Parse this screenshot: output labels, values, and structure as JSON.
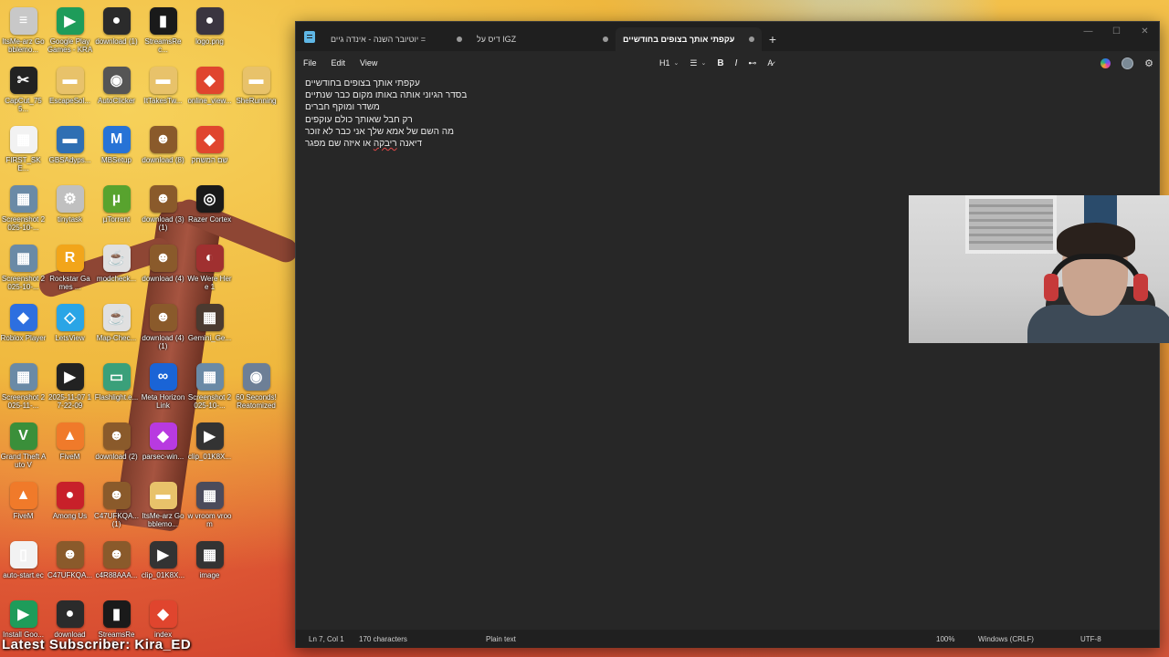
{
  "desktop": {
    "icons": [
      {
        "label": "ItsMe-arz Gobblemo...",
        "glyph": "≡",
        "color": "#c8c8c8"
      },
      {
        "label": "Google Play Games - KRA",
        "glyph": "▶",
        "color": "#1e9c5a"
      },
      {
        "label": "download (1)",
        "glyph": "●",
        "color": "#2b2b2b"
      },
      {
        "label": "StreamsRec...",
        "glyph": "▮",
        "color": "#1a1a1a"
      },
      {
        "label": "logo.png",
        "glyph": "●",
        "color": "#3a3540"
      },
      {
        "label": "",
        "glyph": "",
        "color": "transparent"
      },
      {
        "label": "CapCut_755...",
        "glyph": "✂",
        "color": "#222"
      },
      {
        "label": "EscapeSol...",
        "glyph": "▬",
        "color": "#e8c26a"
      },
      {
        "label": "AutoClicker",
        "glyph": "◉",
        "color": "#555"
      },
      {
        "label": "ItTakesTw...",
        "glyph": "▬",
        "color": "#e8c26a"
      },
      {
        "label": "online_view...",
        "glyph": "◆",
        "color": "#e0452e"
      },
      {
        "label": "SheRunning",
        "glyph": "▬",
        "color": "#e8c26a"
      },
      {
        "label": "FIRST_SKE...",
        "glyph": "▦",
        "color": "#f2f2f2"
      },
      {
        "label": "GBSAdyps...",
        "glyph": "▬",
        "color": "#2f6fb3"
      },
      {
        "label": "MBSetup",
        "glyph": "M",
        "color": "#2773d6"
      },
      {
        "label": "download (8)",
        "glyph": "☻",
        "color": "#8a5a2b"
      },
      {
        "label": "שם המשחק",
        "glyph": "◆",
        "color": "#e0452e"
      },
      {
        "label": "",
        "glyph": "",
        "color": "transparent"
      },
      {
        "label": "Screenshot 2025-10-...",
        "glyph": "▦",
        "color": "#6a8aa6"
      },
      {
        "label": "tinytask",
        "glyph": "⚙",
        "color": "#c0c0c0"
      },
      {
        "label": "µTorrent",
        "glyph": "µ",
        "color": "#58a32e"
      },
      {
        "label": "download (3) (1)",
        "glyph": "☻",
        "color": "#8a5a2b"
      },
      {
        "label": "Razer Cortex",
        "glyph": "◎",
        "color": "#1a1a1a"
      },
      {
        "label": "",
        "glyph": "",
        "color": "transparent"
      },
      {
        "label": "Screenshot 2025-10-...",
        "glyph": "▦",
        "color": "#6a8aa6"
      },
      {
        "label": "Rockstar Games ...",
        "glyph": "R",
        "color": "#f2a51a"
      },
      {
        "label": "modcheck...",
        "glyph": "☕",
        "color": "#e0e0e0"
      },
      {
        "label": "download (4)",
        "glyph": "☻",
        "color": "#8a5a2b"
      },
      {
        "label": "We Were Here 1",
        "glyph": "◐",
        "color": "#a03030"
      },
      {
        "label": "",
        "glyph": "",
        "color": "transparent"
      },
      {
        "label": "Roblox Player",
        "glyph": "◆",
        "color": "#2d6fe0"
      },
      {
        "label": "LetsView",
        "glyph": "◇",
        "color": "#2aa5e6"
      },
      {
        "label": "Map-Chec...",
        "glyph": "☕",
        "color": "#e0e0e0"
      },
      {
        "label": "download (4) (1)",
        "glyph": "☻",
        "color": "#8a5a2b"
      },
      {
        "label": "Gemini_Ge...",
        "glyph": "▦",
        "color": "#4a3a30"
      },
      {
        "label": "",
        "glyph": "",
        "color": "transparent"
      },
      {
        "label": "Screenshot 2025-11-...",
        "glyph": "▦",
        "color": "#6a8aa6"
      },
      {
        "label": "2025-11-07 17-22-09",
        "glyph": "▶",
        "color": "#222"
      },
      {
        "label": "Flashlight.e...",
        "glyph": "▭",
        "color": "#3aa07a"
      },
      {
        "label": "Meta Horizon Link",
        "glyph": "∞",
        "color": "#1a64d6"
      },
      {
        "label": "Screenshot 2025-10-...",
        "glyph": "▦",
        "color": "#6a8aa6"
      },
      {
        "label": "60 Seconds! Reatomized",
        "glyph": "◉",
        "color": "#6d7f96"
      },
      {
        "label": "Grand Theft Auto V",
        "glyph": "V",
        "color": "#3a8f3a"
      },
      {
        "label": "FiveM",
        "glyph": "▲",
        "color": "#f07a2a"
      },
      {
        "label": "download (2)",
        "glyph": "☻",
        "color": "#8a5a2b"
      },
      {
        "label": "parsec-win...",
        "glyph": "◆",
        "color": "#b83ae0"
      },
      {
        "label": "clip_01K8X...",
        "glyph": "▶",
        "color": "#333"
      },
      {
        "label": "",
        "glyph": "",
        "color": "transparent"
      },
      {
        "label": "FiveM",
        "glyph": "▲",
        "color": "#f07a2a"
      },
      {
        "label": "Among Us",
        "glyph": "●",
        "color": "#c8202a"
      },
      {
        "label": "C47UFKQA... (1)",
        "glyph": "☻",
        "color": "#8a5a2b"
      },
      {
        "label": "ItsMe-arz Gobblemo...",
        "glyph": "▬",
        "color": "#e8c26a"
      },
      {
        "label": "w vroom vroom",
        "glyph": "▦",
        "color": "#4b4b5b"
      },
      {
        "label": "",
        "glyph": "",
        "color": "transparent"
      },
      {
        "label": "auto-start.ec",
        "glyph": "▯",
        "color": "#f2f2f2"
      },
      {
        "label": "C47UFKQA...",
        "glyph": "☻",
        "color": "#8a5a2b"
      },
      {
        "label": "c4R88AAA...",
        "glyph": "☻",
        "color": "#8a5a2b"
      },
      {
        "label": "clip_01K8X...",
        "glyph": "▶",
        "color": "#333"
      },
      {
        "label": "image",
        "glyph": "▦",
        "color": "#333"
      },
      {
        "label": "",
        "glyph": "",
        "color": "transparent"
      },
      {
        "label": "Install Goo...",
        "glyph": "▶",
        "color": "#1e9c5a"
      },
      {
        "label": "download",
        "glyph": "●",
        "color": "#2b2b2b"
      },
      {
        "label": "StreamsRec...",
        "glyph": "▮",
        "color": "#1a1a1a"
      },
      {
        "label": "index",
        "glyph": "◆",
        "color": "#e0452e"
      },
      {
        "label": "",
        "glyph": "",
        "color": "transparent"
      },
      {
        "label": "",
        "glyph": "",
        "color": "transparent"
      }
    ],
    "subscriber_banner": "Latest Subscriber: Kira_ED"
  },
  "notepad": {
    "tabs": [
      {
        "label": "יוטיובר השנה - אינדה גיים ="
      },
      {
        "label": "דיס על IGZ"
      },
      {
        "label": "עקפתי אותך בצופים בחודשיים"
      }
    ],
    "new_tab": "+",
    "window_controls": {
      "minimize": "—",
      "maximize": "☐",
      "close": "✕"
    },
    "menu": {
      "file": "File",
      "edit": "Edit",
      "view": "View"
    },
    "format": {
      "heading": "H1",
      "list": "☰",
      "bold": "B",
      "italic": "I",
      "link": "🔗",
      "clear": "A̸"
    },
    "gear": "⚙",
    "lines": [
      "עקפתי אותך בצופים בחודשיים",
      "בסדר הגיוני אותה באותו מקום כבר שנתיים",
      "משדר ומוקף חברים",
      "רק חבל שאותך כולם עוקפים",
      "מה השם של אמא שלך אני כבר לא זוכר"
    ],
    "last_line_pre": "דיאנה ",
    "last_line_misspelled": "ריבקה",
    "last_line_post": " או איזה שם מפגר",
    "status": {
      "position": "Ln 7, Col 1",
      "characters": "170 characters",
      "format": "Plain text",
      "zoom": "100%",
      "line_ending": "Windows (CRLF)",
      "encoding": "UTF-8"
    }
  },
  "colors": {
    "window_bg": "#272727",
    "titlebar_bg": "#1f1f1f",
    "statusbar_bg": "#202020",
    "misspell": "#e04848"
  }
}
